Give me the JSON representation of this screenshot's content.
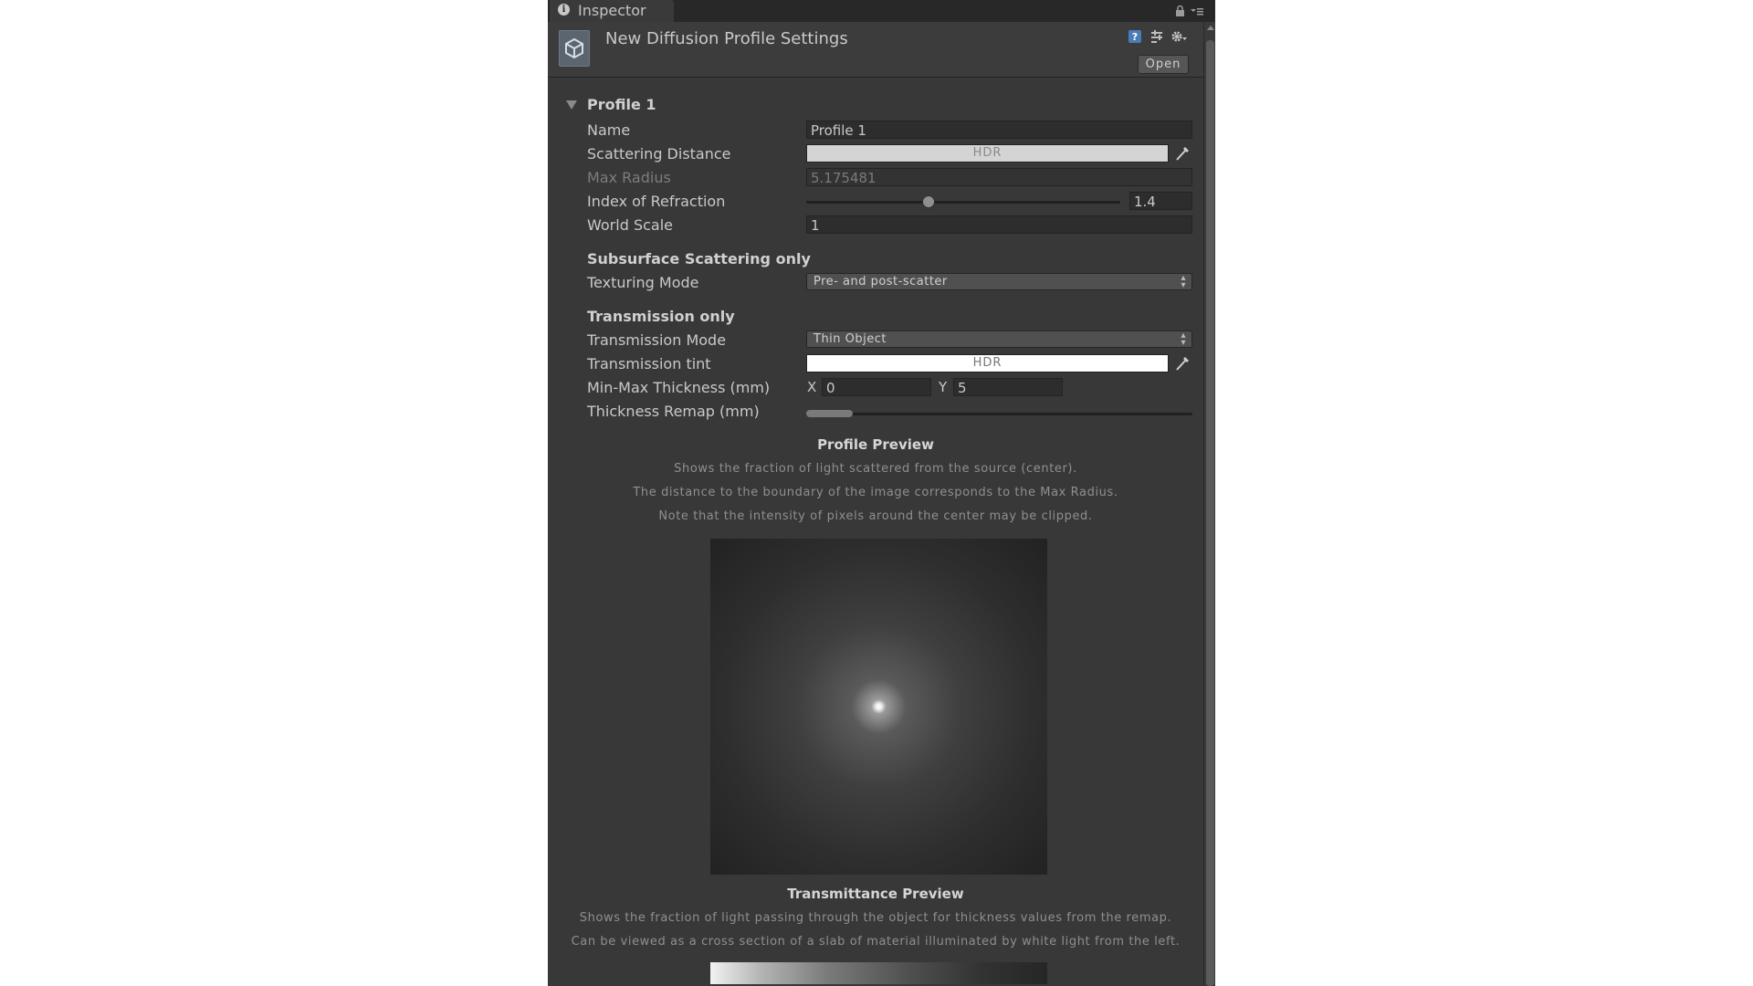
{
  "tab": {
    "label": "Inspector"
  },
  "header": {
    "title": "New Diffusion Profile Settings",
    "open_label": "Open"
  },
  "profile": {
    "foldout_label": "Profile 1",
    "name": {
      "label": "Name",
      "value": "Profile 1"
    },
    "scattering_distance": {
      "label": "Scattering Distance",
      "swatch_text": "HDR",
      "color": "#d4d4d4"
    },
    "max_radius": {
      "label": "Max Radius",
      "value": "5.175481"
    },
    "ior": {
      "label": "Index of Refraction",
      "value": "1.4",
      "slider_fraction": 0.39
    },
    "world_scale": {
      "label": "World Scale",
      "value": "1"
    }
  },
  "subsurface": {
    "heading": "Subsurface Scattering only",
    "texturing_mode": {
      "label": "Texturing Mode",
      "value": "Pre- and post-scatter"
    }
  },
  "transmission": {
    "heading": "Transmission only",
    "mode": {
      "label": "Transmission Mode",
      "value": "Thin Object"
    },
    "tint": {
      "label": "Transmission tint",
      "swatch_text": "HDR",
      "color": "#ffffff"
    },
    "thickness": {
      "label": "Min-Max Thickness (mm)",
      "x_label": "X",
      "x_value": "0",
      "y_label": "Y",
      "y_value": "5"
    },
    "remap": {
      "label": "Thickness Remap (mm)",
      "min_fraction": 0.0,
      "max_fraction": 0.12
    }
  },
  "profile_preview": {
    "title": "Profile Preview",
    "lines": [
      "Shows the fraction of light scattered from the source (center).",
      "The distance to the boundary of the image corresponds to the Max Radius.",
      "Note that the intensity of pixels around the center may be clipped."
    ]
  },
  "transmittance_preview": {
    "title": "Transmittance Preview",
    "lines": [
      "Shows the fraction of light passing through the object for thickness values from the remap.",
      "Can be viewed as a cross section of a slab of material illuminated by white light from the left."
    ]
  },
  "icons": {
    "tab": "info-icon",
    "lock": "lock-icon",
    "menu": "tab-menu-icon",
    "asset": "unity-asset-icon",
    "help": "help-icon",
    "preset": "preset-icon",
    "settings": "gear-icon",
    "picker": "eyedropper-icon"
  }
}
